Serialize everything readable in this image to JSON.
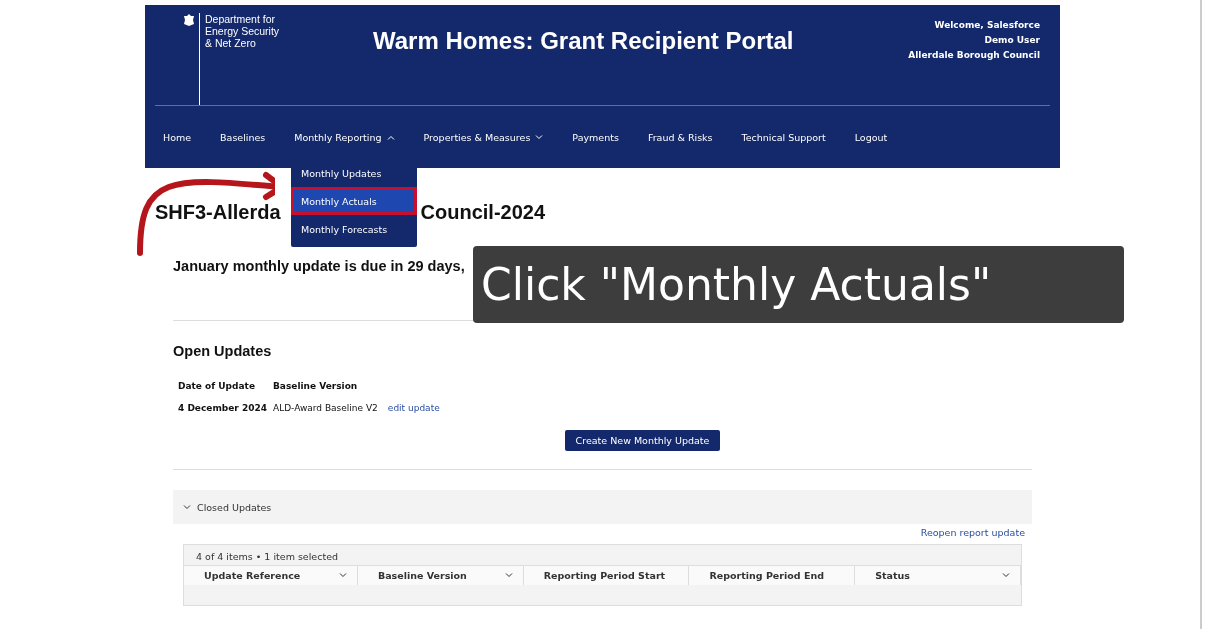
{
  "header": {
    "logo_lines": [
      "Department for",
      "Energy Security",
      "& Net Zero"
    ],
    "title": "Warm Homes: Grant Recipient Portal",
    "user_lines": [
      "Welcome, Salesforce",
      "Demo User",
      "Allerdale Borough Council"
    ]
  },
  "nav": [
    {
      "label": "Home",
      "kind": "link"
    },
    {
      "label": "Baselines",
      "kind": "link"
    },
    {
      "label": "Monthly Reporting",
      "kind": "dropdown",
      "expanded": true
    },
    {
      "label": "Properties & Measures",
      "kind": "dropdown",
      "expanded": false
    },
    {
      "label": "Payments",
      "kind": "link"
    },
    {
      "label": "Fraud & Risks",
      "kind": "link"
    },
    {
      "label": "Technical Support",
      "kind": "link"
    },
    {
      "label": "Logout",
      "kind": "link"
    }
  ],
  "dropdown_menu": [
    {
      "label": "Monthly Updates",
      "selected": false
    },
    {
      "label": "Monthly Actuals",
      "selected": true
    },
    {
      "label": "Monthly Forecasts",
      "selected": false
    }
  ],
  "page_title_parts": [
    "SHF3-Allerda",
    "Council-2024"
  ],
  "due_notice": "January monthly update is due in 29 days,",
  "callout": "Click \"Monthly Actuals\"",
  "open_updates": {
    "heading": "Open Updates",
    "columns": [
      "Date of Update",
      "Baseline Version"
    ],
    "rows": [
      {
        "date": "4 December 2024",
        "baseline": "ALD-Award Baseline V2",
        "link": "edit update"
      }
    ],
    "button": "Create New Monthly Update"
  },
  "closed_updates": {
    "heading": "Closed Updates",
    "expanded": true,
    "reopen_link": "Reopen report update",
    "summary": "4 of 4 items • 1 item selected",
    "columns": [
      {
        "label": "Update Reference",
        "menu": true
      },
      {
        "label": "Baseline Version",
        "menu": true
      },
      {
        "label": "Reporting Period Start",
        "menu": false
      },
      {
        "label": "Reporting Period End",
        "menu": false
      },
      {
        "label": "Status",
        "menu": true
      }
    ]
  }
}
